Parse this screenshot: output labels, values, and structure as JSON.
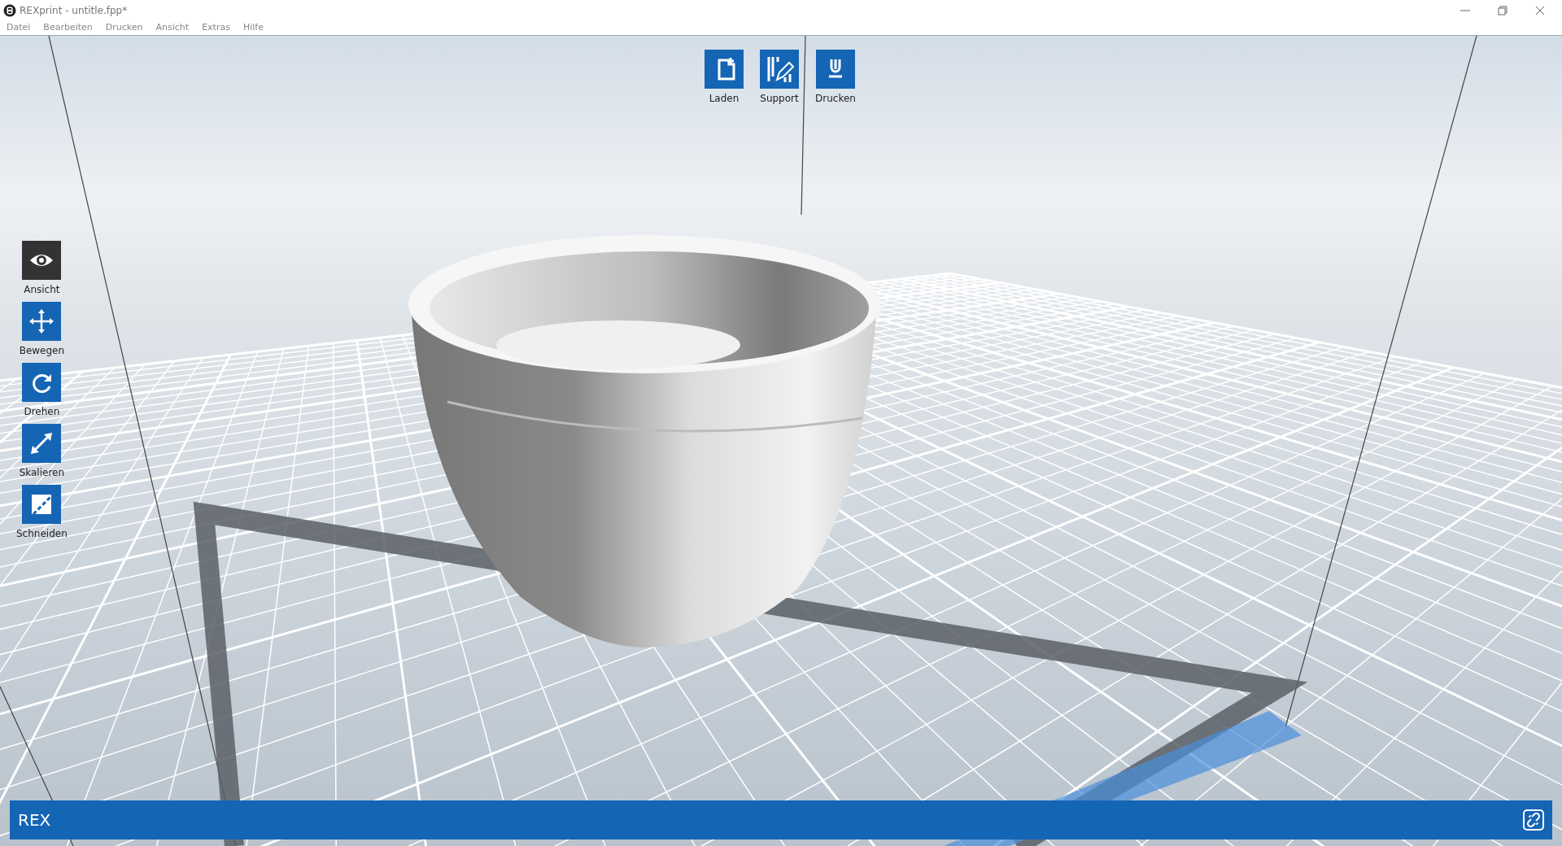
{
  "window": {
    "title": "REXprint - untitle.fpp*"
  },
  "menu": [
    "Datei",
    "Bearbeiten",
    "Drucken",
    "Ansicht",
    "Extras",
    "Hilfe"
  ],
  "top_tools": [
    {
      "label": "Laden",
      "kind": "load"
    },
    {
      "label": "Support",
      "kind": "support"
    },
    {
      "label": "Drucken",
      "kind": "print"
    }
  ],
  "side_tools": [
    {
      "label": "Ansicht",
      "kind": "view",
      "selected": true
    },
    {
      "label": "Bewegen",
      "kind": "move",
      "selected": false
    },
    {
      "label": "Drehen",
      "kind": "rotate",
      "selected": false
    },
    {
      "label": "Skalieren",
      "kind": "scale",
      "selected": false
    },
    {
      "label": "Schneiden",
      "kind": "cut",
      "selected": false
    }
  ],
  "status_bar": {
    "text": "REX"
  }
}
